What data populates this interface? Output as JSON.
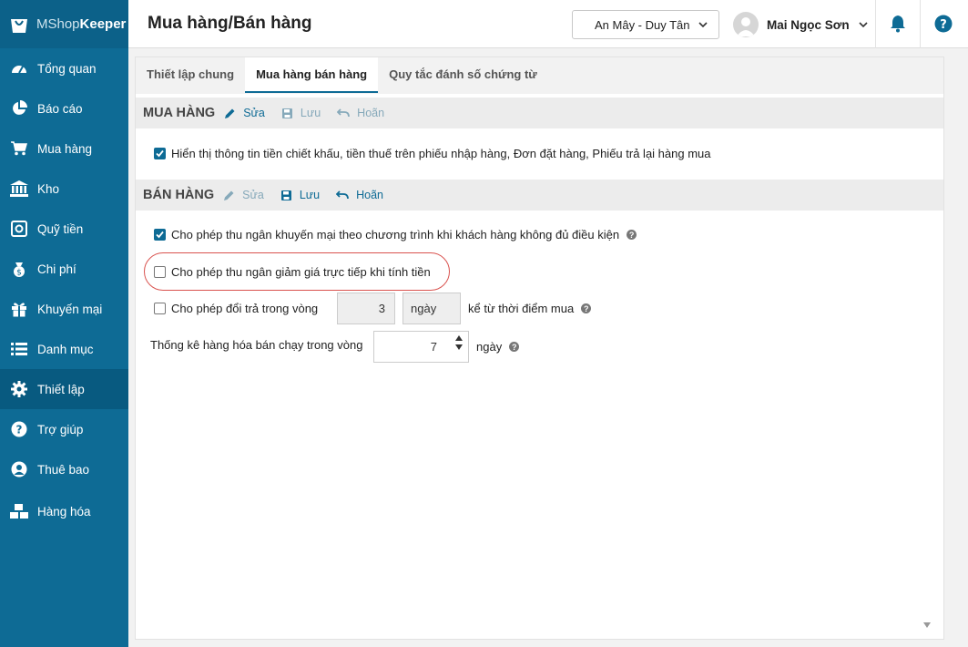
{
  "brand": {
    "name_light": "MShop",
    "name_bold": "Keeper"
  },
  "sidebar": {
    "items": [
      {
        "label": "Tổng quan",
        "icon": "dashboard-icon"
      },
      {
        "label": "Báo cáo",
        "icon": "pie-chart-icon"
      },
      {
        "label": "Mua hàng",
        "icon": "cart-icon"
      },
      {
        "label": "Kho",
        "icon": "bank-icon"
      },
      {
        "label": "Quỹ tiền",
        "icon": "safe-icon"
      },
      {
        "label": "Chi phí",
        "icon": "money-icon"
      },
      {
        "label": "Khuyến mại",
        "icon": "gift-icon"
      },
      {
        "label": "Danh mục",
        "icon": "list-icon"
      },
      {
        "label": "Thiết lập",
        "icon": "gear-icon"
      },
      {
        "label": "Trợ giúp",
        "icon": "question-icon"
      },
      {
        "label": "Thuê bao",
        "icon": "user-icon"
      },
      {
        "label": "Hàng hóa",
        "icon": "boxes-icon"
      }
    ],
    "active_index": 8
  },
  "header": {
    "title": "Mua hàng/Bán hàng",
    "store": "An Mây - Duy Tân",
    "user_name": "Mai Ngọc Sơn"
  },
  "tabs": [
    {
      "label": "Thiết lập chung"
    },
    {
      "label": "Mua hàng bán hàng"
    },
    {
      "label": "Quy tắc đánh số chứng từ"
    }
  ],
  "purchase": {
    "title": "MUA HÀNG",
    "edit": "Sửa",
    "save": "Lưu",
    "cancel": "Hoãn",
    "option1": "Hiển thị thông tin tiền chiết khấu, tiền thuế trên phiếu nhập hàng, Đơn đặt hàng, Phiếu trả lại hàng mua",
    "option1_checked": true
  },
  "sales": {
    "title": "BÁN HÀNG",
    "edit": "Sửa",
    "save": "Lưu",
    "cancel": "Hoãn",
    "option_promo": "Cho phép thu ngân khuyến mại theo chương trình khi khách hàng không đủ điều kiện",
    "option_promo_checked": true,
    "option_discount": "Cho phép thu ngân giảm giá trực tiếp khi tính tiền",
    "option_discount_checked": false,
    "option_return": "Cho phép đổi trả trong vòng",
    "option_return_checked": false,
    "return_value": "3",
    "return_unit": "ngày",
    "return_suffix": "kể từ thời điểm mua",
    "bestseller_label": "Thống kê hàng hóa bán chạy trong vòng",
    "bestseller_value": "7",
    "bestseller_unit": "ngày"
  },
  "colors": {
    "sidebar": "#0e6b95",
    "accent": "#0e6b95",
    "highlight": "#d9534f"
  }
}
